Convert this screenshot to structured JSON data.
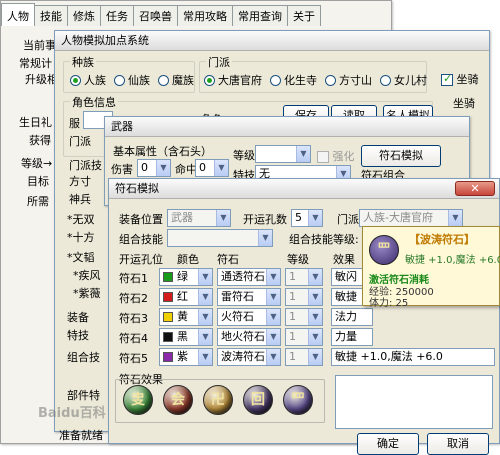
{
  "main_tabs": [
    "人物",
    "技能",
    "修炼",
    "任务",
    "召唤兽",
    "常用攻略",
    "常用查询",
    "关于"
  ],
  "main_window": {
    "partial_labels": [
      "当前事",
      "常规计",
      "升级相",
      "生日礼",
      "获得",
      "等级→",
      "目标",
      "所需"
    ]
  },
  "character_window": {
    "title": "人物模拟加点系统",
    "race_group": "种族",
    "races": [
      {
        "label": "人族",
        "selected": true
      },
      {
        "label": "仙族",
        "selected": false
      },
      {
        "label": "魔族",
        "selected": false
      }
    ],
    "sect_group": "门派",
    "sects": [
      {
        "label": "大唐官府",
        "selected": true
      },
      {
        "label": "化生寺",
        "selected": false
      },
      {
        "label": "方寸山",
        "selected": false
      },
      {
        "label": "女儿村",
        "selected": false
      }
    ],
    "mount_label": "坐骑",
    "mount_checked": true,
    "mount_label_2": "坐骑",
    "info_group": "角色信息",
    "partial_fields": [
      "服",
      "角色",
      "保存",
      "读取",
      "名人模拟",
      "门派"
    ],
    "left_partials": [
      "门派技",
      "方寸",
      "神兵",
      "*无双",
      "*十方",
      "*文韬",
      "*疾风",
      "*紫薇",
      "装备",
      "特技",
      "组合技",
      "部件特",
      "准备就绪"
    ]
  },
  "weapon_window": {
    "title": "武器",
    "base_attr": "基本属性（含石头）",
    "damage_label": "伤害",
    "damage_value": "0",
    "hit_label": "命中",
    "hit_value": "0",
    "level_label": "等级",
    "strengthen_label": "强化",
    "stone_sim_button": "符石模拟",
    "special_label": "特技",
    "special_value": "无",
    "stone_combo_label": "符石组合"
  },
  "stone_window": {
    "title": "符石模拟",
    "close_label": "✕",
    "equip_pos_label": "装备位置",
    "equip_pos_value": "武器",
    "holes_label": "开运孔数",
    "holes_value": "5",
    "sect_label": "门派",
    "sect_value": "人族-大唐官府",
    "combo_skill_label": "组合技能",
    "combo_level_label": "组合技能等级:",
    "headers": [
      "开运孔位",
      "颜色",
      "符石",
      "等级",
      "效果"
    ],
    "rows": [
      {
        "slot": "符石1",
        "color": "绿",
        "swatch": "#1a9a1a",
        "stone": "通透符石",
        "level": "1",
        "effect": "敏闪"
      },
      {
        "slot": "符石2",
        "color": "红",
        "swatch": "#d41c1c",
        "stone": "雷符石",
        "level": "1",
        "effect": "敏捷"
      },
      {
        "slot": "符石3",
        "color": "黄",
        "swatch": "#f0d000",
        "stone": "火符石",
        "level": "1",
        "effect": "法力"
      },
      {
        "slot": "符石4",
        "color": "黑",
        "swatch": "#101010",
        "stone": "地火符石",
        "level": "1",
        "effect": "力量"
      },
      {
        "slot": "符石5",
        "color": "紫",
        "swatch": "#8a2aa8",
        "stone": "波涛符石",
        "level": "1",
        "effect": "敏捷 +1.0,魔法 +6.0"
      }
    ],
    "effects_label": "符石效果",
    "gems": [
      {
        "name": "green-stone-icon",
        "glyph": "㕜",
        "color": "#3d8a3d"
      },
      {
        "name": "red-stone-icon",
        "glyph": "会",
        "color": "#8c3a2a"
      },
      {
        "name": "yellow-stone-icon",
        "glyph": "卍",
        "color": "#b48a3a"
      },
      {
        "name": "black-stone-icon",
        "glyph": "回",
        "color": "#4a3a6a"
      },
      {
        "name": "purple-stone-icon",
        "glyph": "罒",
        "color": "#5a4a8a"
      }
    ],
    "confirm_button": "确定",
    "cancel_button": "取消"
  },
  "tooltip": {
    "title": "【波涛符石】",
    "effect": "敏捷 +1.0,魔法 +6.0",
    "status": "激活符石消耗",
    "exp": "经验: 250000",
    "stamina": "体力: 25"
  },
  "watermark": "Baidu百科"
}
